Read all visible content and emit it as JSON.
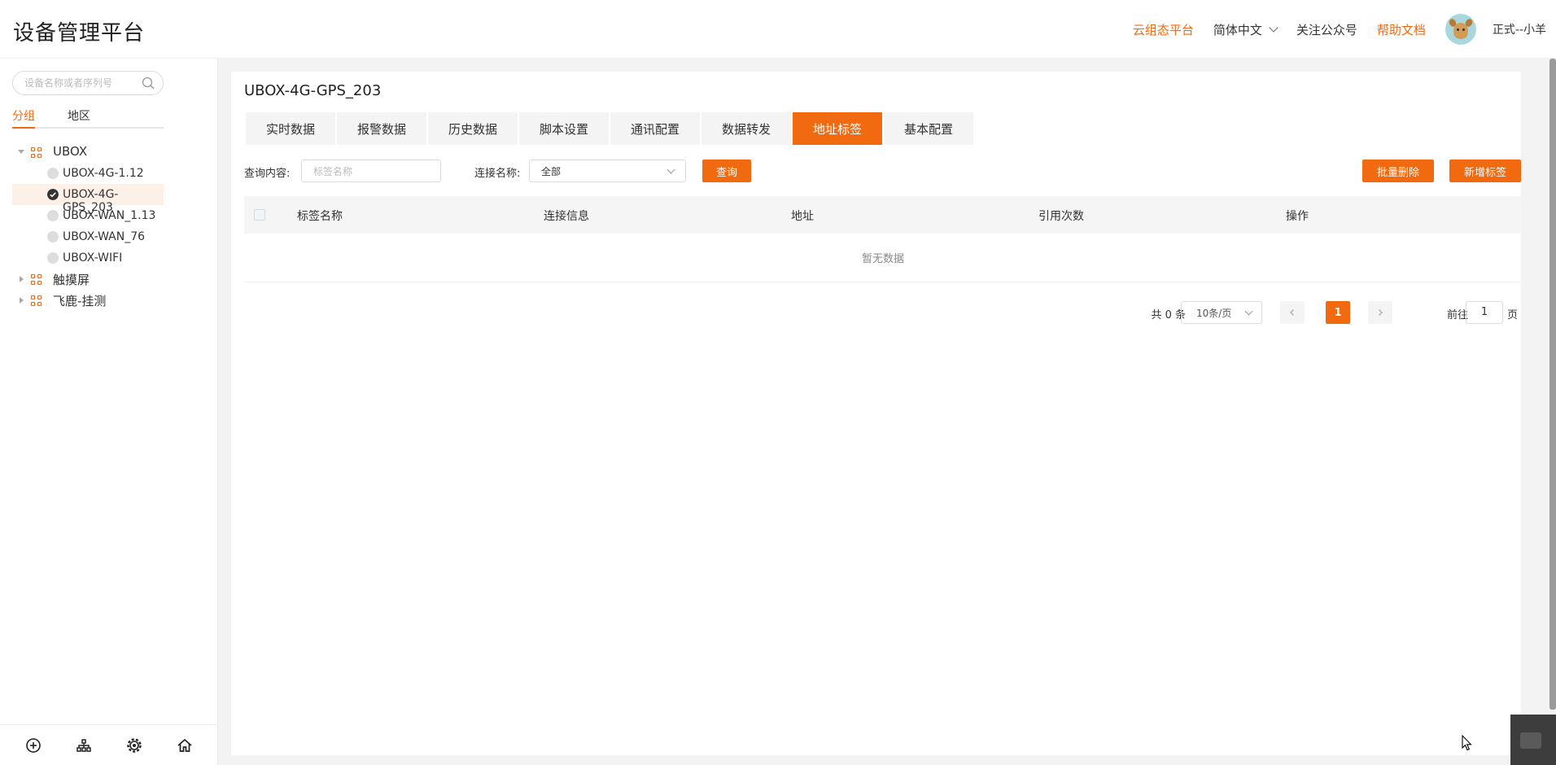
{
  "header": {
    "app_title": "设备管理平台",
    "nav": {
      "cloud_platform": "云组态平台",
      "language": "简体中文",
      "follow": "关注公众号",
      "help": "帮助文档"
    },
    "user": "正式--小羊"
  },
  "sidebar": {
    "search_placeholder": "设备名称或者序列号",
    "tabs": {
      "group": "分组",
      "region": "地区"
    },
    "tree": {
      "group_ubox": "UBOX",
      "children": [
        {
          "label": "UBOX-4G-1.12",
          "online": false
        },
        {
          "label": "UBOX-4G-GPS_203",
          "online": true
        },
        {
          "label": "UBOX-WAN_1.13",
          "online": false
        },
        {
          "label": "UBOX-WAN_76",
          "online": false
        },
        {
          "label": "UBOX-WIFI",
          "online": false
        }
      ],
      "group_touch": "触摸屏",
      "group_feilu": "飞鹿-挂测"
    }
  },
  "main": {
    "device_title": "UBOX-4G-GPS_203",
    "tabs": [
      "实时数据",
      "报警数据",
      "历史数据",
      "脚本设置",
      "通讯配置",
      "数据转发",
      "地址标签",
      "基本配置"
    ],
    "active_tab": "地址标签",
    "filter": {
      "query_label": "查询内容:",
      "query_placeholder": "标签名称",
      "conn_label": "连接名称:",
      "conn_value": "全部",
      "query_button": "查询",
      "batch_delete": "批量删除",
      "add_tag": "新增标签"
    },
    "table": {
      "columns": [
        "标签名称",
        "连接信息",
        "地址",
        "引用次数",
        "操作"
      ],
      "empty_text": "暂无数据"
    },
    "pagination": {
      "total": "共 0 条",
      "page_size": "10条/页",
      "current_page": "1",
      "goto_label": "前往",
      "goto_value": "1",
      "page_unit": "页"
    }
  },
  "colors": {
    "accent": "#f26a10"
  }
}
